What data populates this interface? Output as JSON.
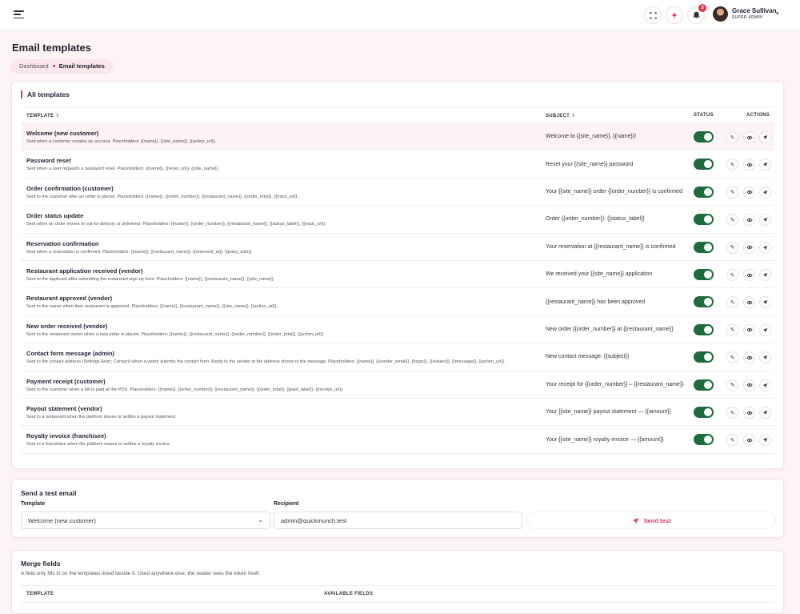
{
  "header": {
    "user_name": "Grace Sullivan",
    "user_role": "SUPER ADMIN",
    "notification_count": "3",
    "icons": [
      "menu-icon",
      "fullscreen-icon",
      "sparkle-icon",
      "bell-icon",
      "chevron-down-icon"
    ]
  },
  "page": {
    "title": "Email templates",
    "breadcrumb": {
      "home": "Dashboard",
      "current": "Email templates"
    }
  },
  "templates": {
    "section_title": "All templates",
    "columns": {
      "template": "TEMPLATE",
      "subject": "SUBJECT",
      "status": "STATUS",
      "actions": "ACTIONS"
    },
    "rows": [
      {
        "name": "Welcome (new customer)",
        "desc": "Sent when a customer creates an account. Placeholders: {{name}}, {{site_name}}, {{action_url}}.",
        "subject": "Welcome to {{site_name}}, {{name}}!",
        "enabled": true
      },
      {
        "name": "Password reset",
        "desc": "Sent when a user requests a password reset. Placeholders: {{name}}, {{reset_url}}, {{site_name}}.",
        "subject": "Reset your {{site_name}} password",
        "enabled": true
      },
      {
        "name": "Order confirmation (customer)",
        "desc": "Sent to the customer after an order is placed. Placeholders: {{name}}, {{order_number}}, {{restaurant_name}}, {{order_total}}, {{track_url}}.",
        "subject": "Your {{site_name}} order {{order_number}} is confirmed",
        "enabled": true
      },
      {
        "name": "Order status update",
        "desc": "Sent when an order moves to out for delivery or delivered. Placeholders: {{name}}, {{order_number}}, {{restaurant_name}}, {{status_label}}, {{track_url}}.",
        "subject": "Order {{order_number}}: {{status_label}}",
        "enabled": true
      },
      {
        "name": "Reservation confirmation",
        "desc": "Sent when a reservation is confirmed. Placeholders: {{name}}, {{restaurant_name}}, {{reserved_at}}, {{party_size}}.",
        "subject": "Your reservation at {{restaurant_name}} is confirmed",
        "enabled": true
      },
      {
        "name": "Restaurant application received (vendor)",
        "desc": "Sent to the applicant after submitting the restaurant sign-up form. Placeholders: {{name}}, {{restaurant_name}}, {{site_name}}.",
        "subject": "We received your {{site_name}} application",
        "enabled": true
      },
      {
        "name": "Restaurant approved (vendor)",
        "desc": "Sent to the owner when their restaurant is approved. Placeholders: {{name}}, {{restaurant_name}}, {{site_name}}, {{action_url}}.",
        "subject": "{{restaurant_name}} has been approved",
        "enabled": true
      },
      {
        "name": "New order received (vendor)",
        "desc": "Sent to the restaurant owner when a new order is placed. Placeholders: {{name}}, {{restaurant_name}}, {{order_number}}, {{order_total}}, {{action_url}}.",
        "subject": "New order {{order_number}} at {{restaurant_name}}",
        "enabled": true
      },
      {
        "name": "Contact form message (admin)",
        "desc": "Sent to the contact address (Settings &rarr; Contact) when a visitor submits the contact form. Reply to the sender at the address shown in the message. Placeholders: {{name}}, {{sender_email}}, {{topic}}, {{subject}}, {{message}}, {{action_url}}.",
        "subject": "New contact message: {{subject}}",
        "enabled": true
      },
      {
        "name": "Payment receipt (customer)",
        "desc": "Sent to the customer when a bill is paid at the POS. Placeholders: {{name}}, {{order_number}}, {{restaurant_name}}, {{order_total}}, {{paid_label}}, {{receipt_url}}.",
        "subject": "Your receipt for {{order_number}} – {{restaurant_name}}",
        "enabled": true
      },
      {
        "name": "Payout statement (vendor)",
        "desc": "Sent to a restaurant when the platform issues or settles a payout statement.",
        "subject": "Your {{site_name}} payout statement — {{amount}}",
        "enabled": true
      },
      {
        "name": "Royalty invoice (franchisee)",
        "desc": "Sent to a franchisee when the platform issues or settles a royalty invoice.",
        "subject": "Your {{site_name}} royalty invoice — {{amount}}",
        "enabled": true
      }
    ]
  },
  "send_test": {
    "section_title": "Send a test email",
    "template_label": "Template",
    "template_value": "Welcome (new customer)",
    "recipient_label": "Recipient",
    "recipient_value": "admin@quickmunch.test",
    "button_label": "Send test"
  },
  "merge_fields": {
    "section_title": "Merge fields",
    "subtitle": "A field only fills in on the templates listed beside it. Used anywhere else, the reader sees the token itself.",
    "columns": {
      "template": "TEMPLATE",
      "available": "AVAILABLE FIELDS"
    }
  },
  "colors": {
    "accent": "#e0356a",
    "toggle_on": "#1e6b3c",
    "page_bg": "#fdf4f5"
  }
}
